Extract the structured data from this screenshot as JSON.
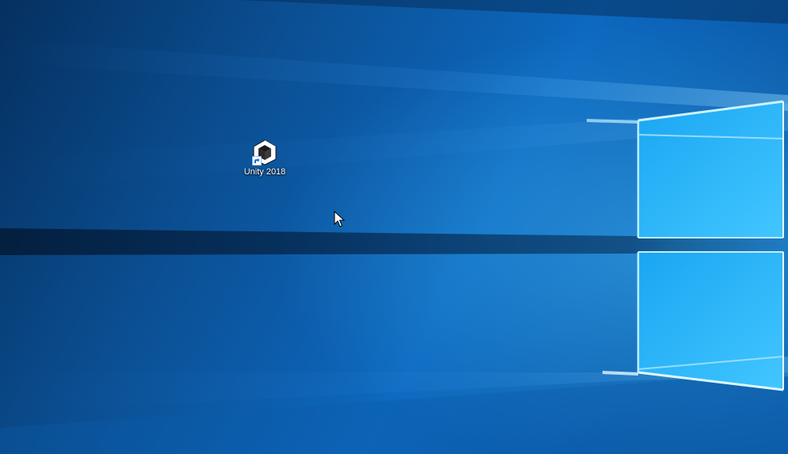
{
  "desktop": {
    "icons": [
      {
        "label": "Unity 2018",
        "icon": "unity-logo-icon",
        "shortcut_overlay": "shortcut-arrow-icon"
      }
    ],
    "cursor": "arrow-pointer"
  },
  "colors": {
    "wallpaper_base": "#0a4a8a",
    "wallpaper_light": "#5ccfff",
    "label_text": "#ffffff"
  }
}
